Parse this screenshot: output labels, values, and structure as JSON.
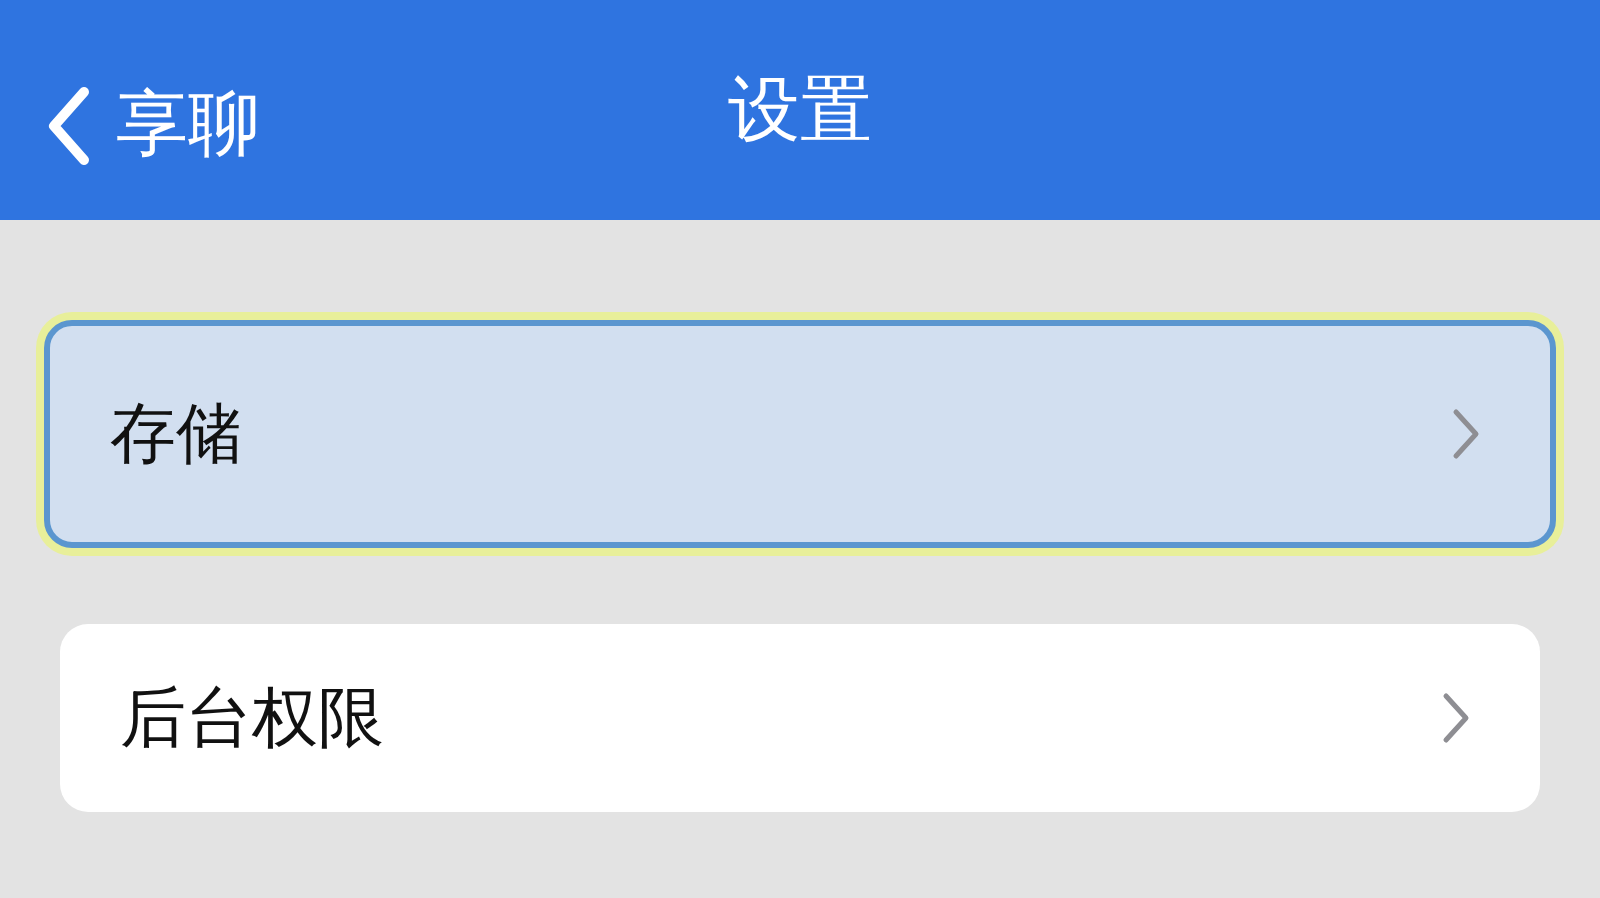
{
  "header": {
    "back_label": "享聊",
    "title": "设置"
  },
  "items": [
    {
      "label": "存储",
      "selected": true
    },
    {
      "label": "后台权限",
      "selected": false
    }
  ]
}
